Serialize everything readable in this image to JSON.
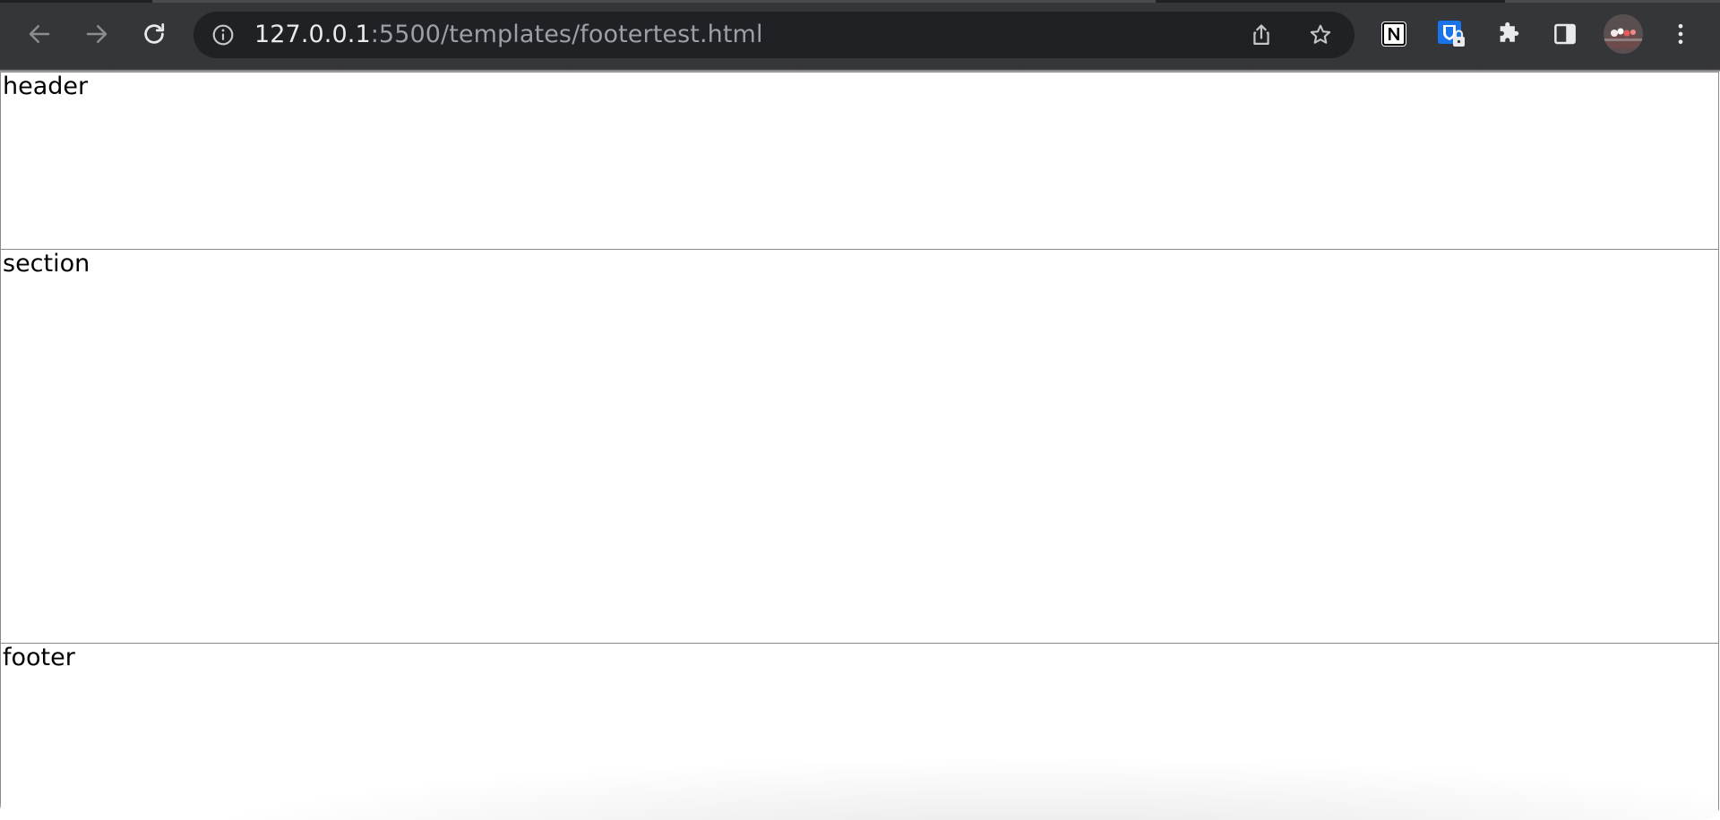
{
  "browser": {
    "url_host": "127.0.0.1",
    "url_rest": ":5500/templates/footertest.html",
    "toolbar_color": "#35363a",
    "omnibox_color": "#202124",
    "icons": {
      "back": "arrow-left-icon",
      "forward": "arrow-right-icon",
      "reload": "reload-icon",
      "site_info": "info-icon",
      "share": "share-icon",
      "bookmark": "star-icon",
      "notion": "notion-icon",
      "password_manager": "shield-lock-icon",
      "extensions": "puzzle-icon",
      "side_panel": "side-panel-icon",
      "profile": "avatar",
      "menu": "kebab-menu-icon"
    }
  },
  "page": {
    "header_label": "header",
    "section_label": "section",
    "footer_label": "footer",
    "border_color": "#8a8a8a"
  }
}
